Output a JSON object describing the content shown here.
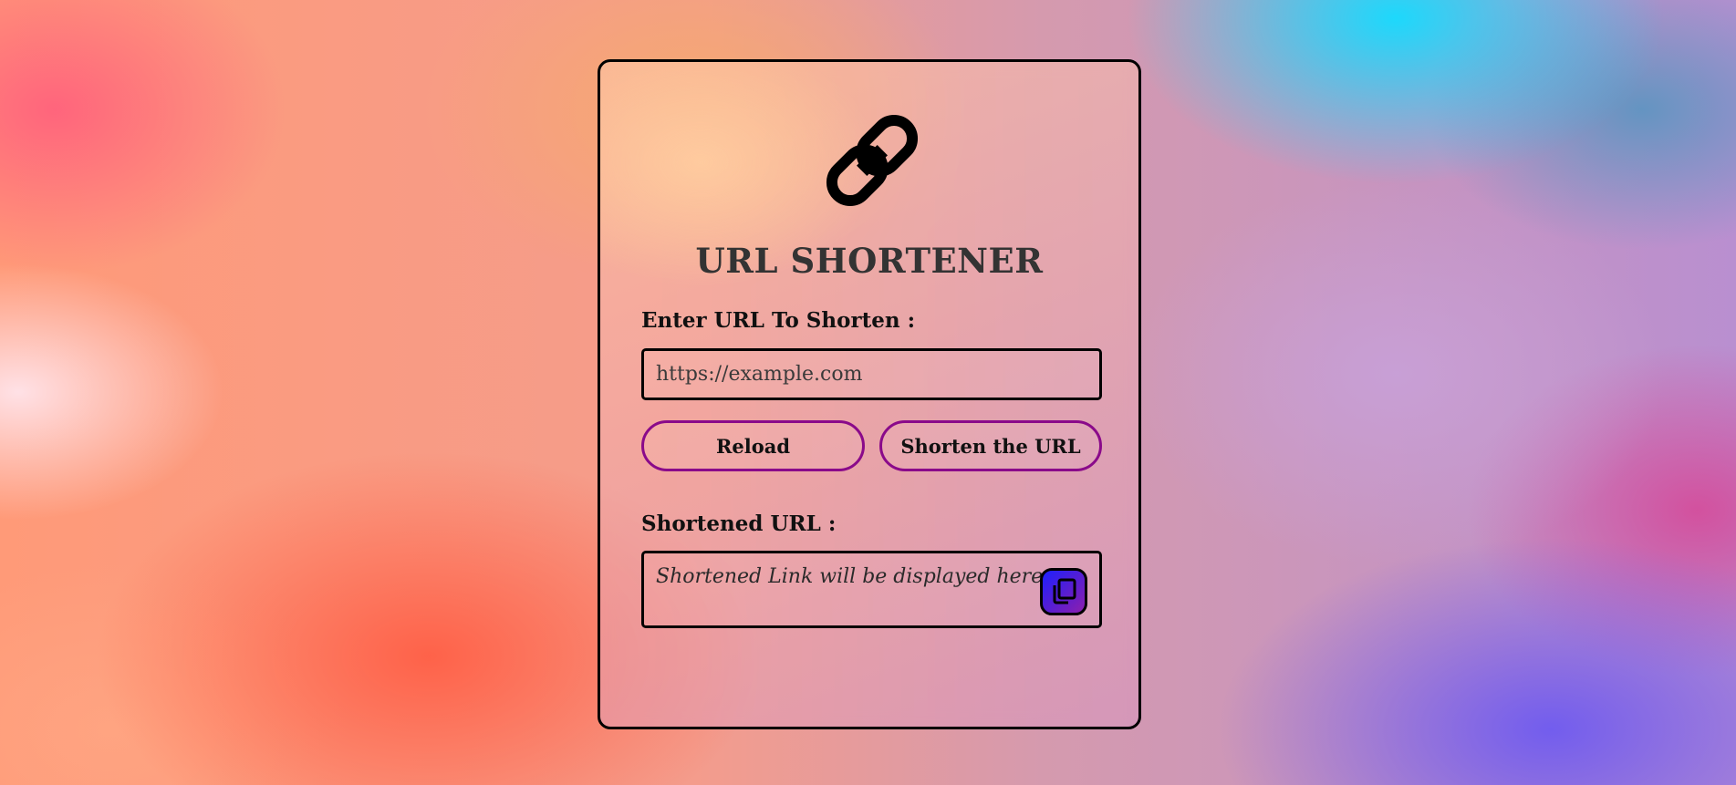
{
  "app": {
    "title": "URL SHORTENER"
  },
  "form": {
    "input_label": "Enter URL To Shorten :",
    "input_placeholder": "https://example.com",
    "input_value": ""
  },
  "buttons": {
    "reload": "Reload",
    "shorten": "Shorten the URL"
  },
  "result": {
    "label": "Shortened URL :",
    "placeholder_text": "Shortened Link will be displayed here"
  },
  "icons": {
    "logo": "link-icon",
    "copy": "copy-icon"
  },
  "colors": {
    "button_border": "#8a0a8a",
    "copy_button_gradient_start": "#1d20ff",
    "copy_button_gradient_end": "#8d1fae",
    "title_text": "#333333"
  }
}
